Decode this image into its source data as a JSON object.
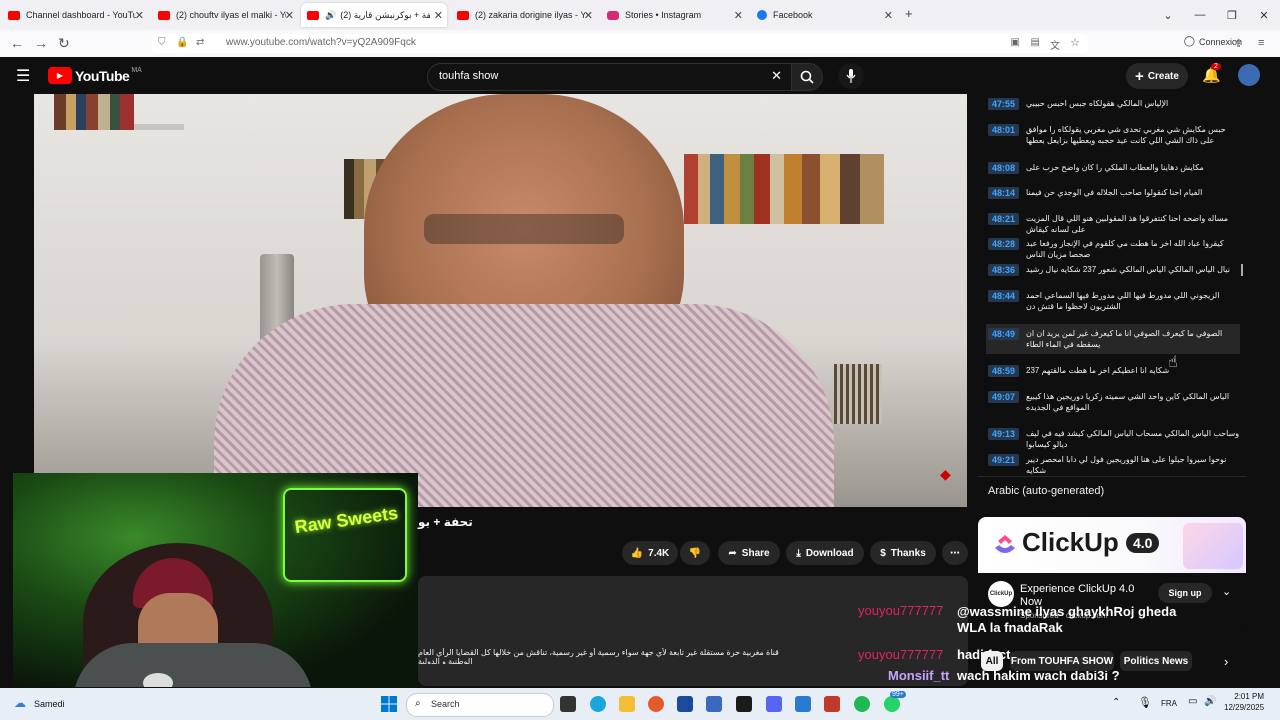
{
  "browser": {
    "tabs": [
      {
        "title": "Channel dashboard - YouTube S",
        "color": "#ff0000"
      },
      {
        "title": "(2) chouftv ilyas el malki - YouTu",
        "color": "#ff0000"
      },
      {
        "title": "(2) تحفة + بوكرنبشن قارية",
        "color": "#ff0000"
      },
      {
        "title": "(2) zakaria dorigine ilyas - YouTu",
        "color": "#ff0000"
      },
      {
        "title": "Stories • Instagram",
        "color": "#d62976"
      },
      {
        "title": "Facebook",
        "color": "#1877f2"
      }
    ],
    "url": "www.youtube.com/watch?v=yQ2A909Fqck",
    "connexion": "Connexion"
  },
  "youtube": {
    "logo_text": "YouTube",
    "region": "MA",
    "search_value": "touhfa show",
    "create_label": "Create",
    "notif_count": "2"
  },
  "chapters": [
    {
      "time": "47:55",
      "text": "الإلياس المالكي هقولكاه جبس احبس حبيبي"
    },
    {
      "time": "48:01",
      "text": "حبس مكايش شي مغربي تحدى شي مغربي يقولكاه را موافق على ذاك الشي اللي كانت عيد حجبه ويعطيها بزايعل بعطها"
    },
    {
      "time": "48:08",
      "text": "مكايش دهاينا والعطاب الملكي را كان واضح حرب على"
    },
    {
      "time": "48:14",
      "text": "الفيام احنا كنقولوا صاحب الجلاله في الوجدي حن فيمنا"
    },
    {
      "time": "48:21",
      "text": "مساله واضحه احنا كنتفرقوا هذ المقولبين هنو اللي قال المزيت على لسانه كيقاش"
    },
    {
      "time": "48:28",
      "text": "كيقروا عباد الله اخر ما هطت مي كلقوم في الإنجاز ورفعا عبد صحصا مزيان الناس"
    },
    {
      "time": "48:36",
      "text": "نيال الياس المالكي الياس المالكي شعور 237 شكايه نيال رشيد"
    },
    {
      "time": "48:44",
      "text": "الزيجوني اللي مدورط فيها اللي مدورط فيها السماعي احمد الشتريون لاحظوا ما قتش دن"
    },
    {
      "time": "48:49",
      "text": "الصوفي ما كيعرف الصوفي انا ما كيعرف غير لمن يريد ان ان يسقطه في الماء الطاء"
    },
    {
      "time": "48:59",
      "text": "شكايه انا اعطيكم اخر ما هطت مالقتهم 237"
    },
    {
      "time": "49:07",
      "text": "الياس المالكي كاين واحد الشي سميته زكريا دوريجين هذا كيبيع المواقع في الجديده"
    },
    {
      "time": "49:13",
      "text": "وساحب الياس المالكي مسحاب الياس المالكي كيشد فيه في ليف ديالو كيسابوا"
    },
    {
      "time": "49:21",
      "text": "نوحوا سيروا جيلوا على هنا الووريجين فول لي دابا امحصر ديير شكايه"
    }
  ],
  "captions_label": "Arabic (auto-generated)",
  "video_title": "تحفة + بو",
  "actions": {
    "likes": "7.4K",
    "share": "Share",
    "download": "Download",
    "thanks": "Thanks"
  },
  "description": "قناة مغربية حرة مستقلة غير تابعة لأي جهة سواء رسمية أو غير رسمية، تناقش من خلالها كل القضايا الرأي العام الوطنية و الدولية",
  "ad": {
    "brand": "ClickUp",
    "version": "4.0",
    "headline": "Experience ClickUp 4.0 Now",
    "sponsored": "Sponsored",
    "domain": "clickup.com",
    "signup": "Sign up",
    "avatar_text": "ClickUp"
  },
  "chat": [
    {
      "name": "youyou777777",
      "msg": "@wassmine ilyas ghaykhRoj gheda WLA la fnadaRak"
    },
    {
      "name": "youyou777777",
      "msg": "hadi fact"
    },
    {
      "name": "Monsiif_tt",
      "msg": "wach hakim wach dabi3i ?"
    }
  ],
  "chips": [
    "All",
    "From TOUHFA SHOW",
    "Politics News"
  ],
  "webcam": {
    "neon_text": "Raw Sweets"
  },
  "taskbar": {
    "weather": "Samedi",
    "search_placeholder": "Search",
    "lang": "FRA",
    "time": "2:01 PM",
    "date": "12/29/2025",
    "badge": "99+"
  }
}
